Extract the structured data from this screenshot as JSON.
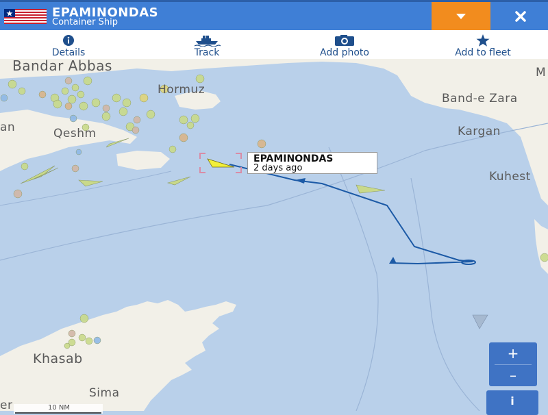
{
  "header": {
    "ship_name": "EPAMINONDAS",
    "ship_type": "Container Ship"
  },
  "toolbar": {
    "items": [
      {
        "label": "Details",
        "icon": "info-icon"
      },
      {
        "label": "Track",
        "icon": "ship-icon"
      },
      {
        "label": "Add photo",
        "icon": "camera-icon"
      },
      {
        "label": "Add to fleet",
        "icon": "star-icon"
      }
    ]
  },
  "map": {
    "labels": {
      "bandar_abbas": "Bandar Abbas",
      "hormuz": "Hormuz",
      "qeshm": "Qeshm",
      "an": "an",
      "band_e_zara": "Band-e Zara",
      "kargan": "Kargan",
      "kuhest": "Kuhest",
      "m": "M",
      "khasab": "Khasab",
      "sima": "Sima",
      "er": "er"
    },
    "callout": {
      "name": "EPAMINONDAS",
      "time": "2 days ago"
    },
    "scale": "10 NM",
    "colors": {
      "water": "#b9d0ea",
      "land": "#f2f0e8",
      "track": "#1c5aa6",
      "header": "#3f7fd6",
      "dropdown": "#f28c1e"
    }
  },
  "controls": {
    "zoom_in": "+",
    "zoom_out": "–",
    "info": "i"
  }
}
